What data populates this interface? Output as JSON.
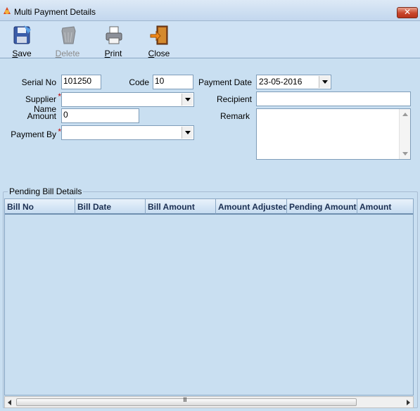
{
  "window": {
    "title": "Multi Payment Details"
  },
  "toolbar": {
    "save": {
      "label": "Save",
      "icon": "floppy-disk-icon"
    },
    "delete": {
      "label": "Delete",
      "icon": "trash-icon"
    },
    "print": {
      "label": "Print",
      "icon": "printer-icon"
    },
    "close": {
      "label": "Close",
      "icon": "exit-door-icon"
    }
  },
  "form": {
    "serial_no": {
      "label": "Serial No",
      "value": "101250"
    },
    "code": {
      "label": "Code",
      "value": "10"
    },
    "payment_date": {
      "label": "Payment Date",
      "value": "23-05-2016"
    },
    "supplier_name": {
      "label": "Supplier Name",
      "value": ""
    },
    "recipient": {
      "label": "Recipient",
      "value": ""
    },
    "amount": {
      "label": "Amount",
      "value": "0"
    },
    "remark": {
      "label": "Remark",
      "value": ""
    },
    "payment_by": {
      "label": "Payment By",
      "value": ""
    },
    "required_mark": "*"
  },
  "pending_bills": {
    "title": "Pending Bill Details",
    "columns": [
      "Bill No",
      "Bill Date",
      "Bill Amount",
      "Amount Adjusted",
      "Pending Amount",
      "Amount"
    ],
    "rows": [],
    "scroll_grip": "III"
  },
  "colors": {
    "background": "#c9dff1",
    "required": "#c00000",
    "close_button": "#c8452b"
  }
}
